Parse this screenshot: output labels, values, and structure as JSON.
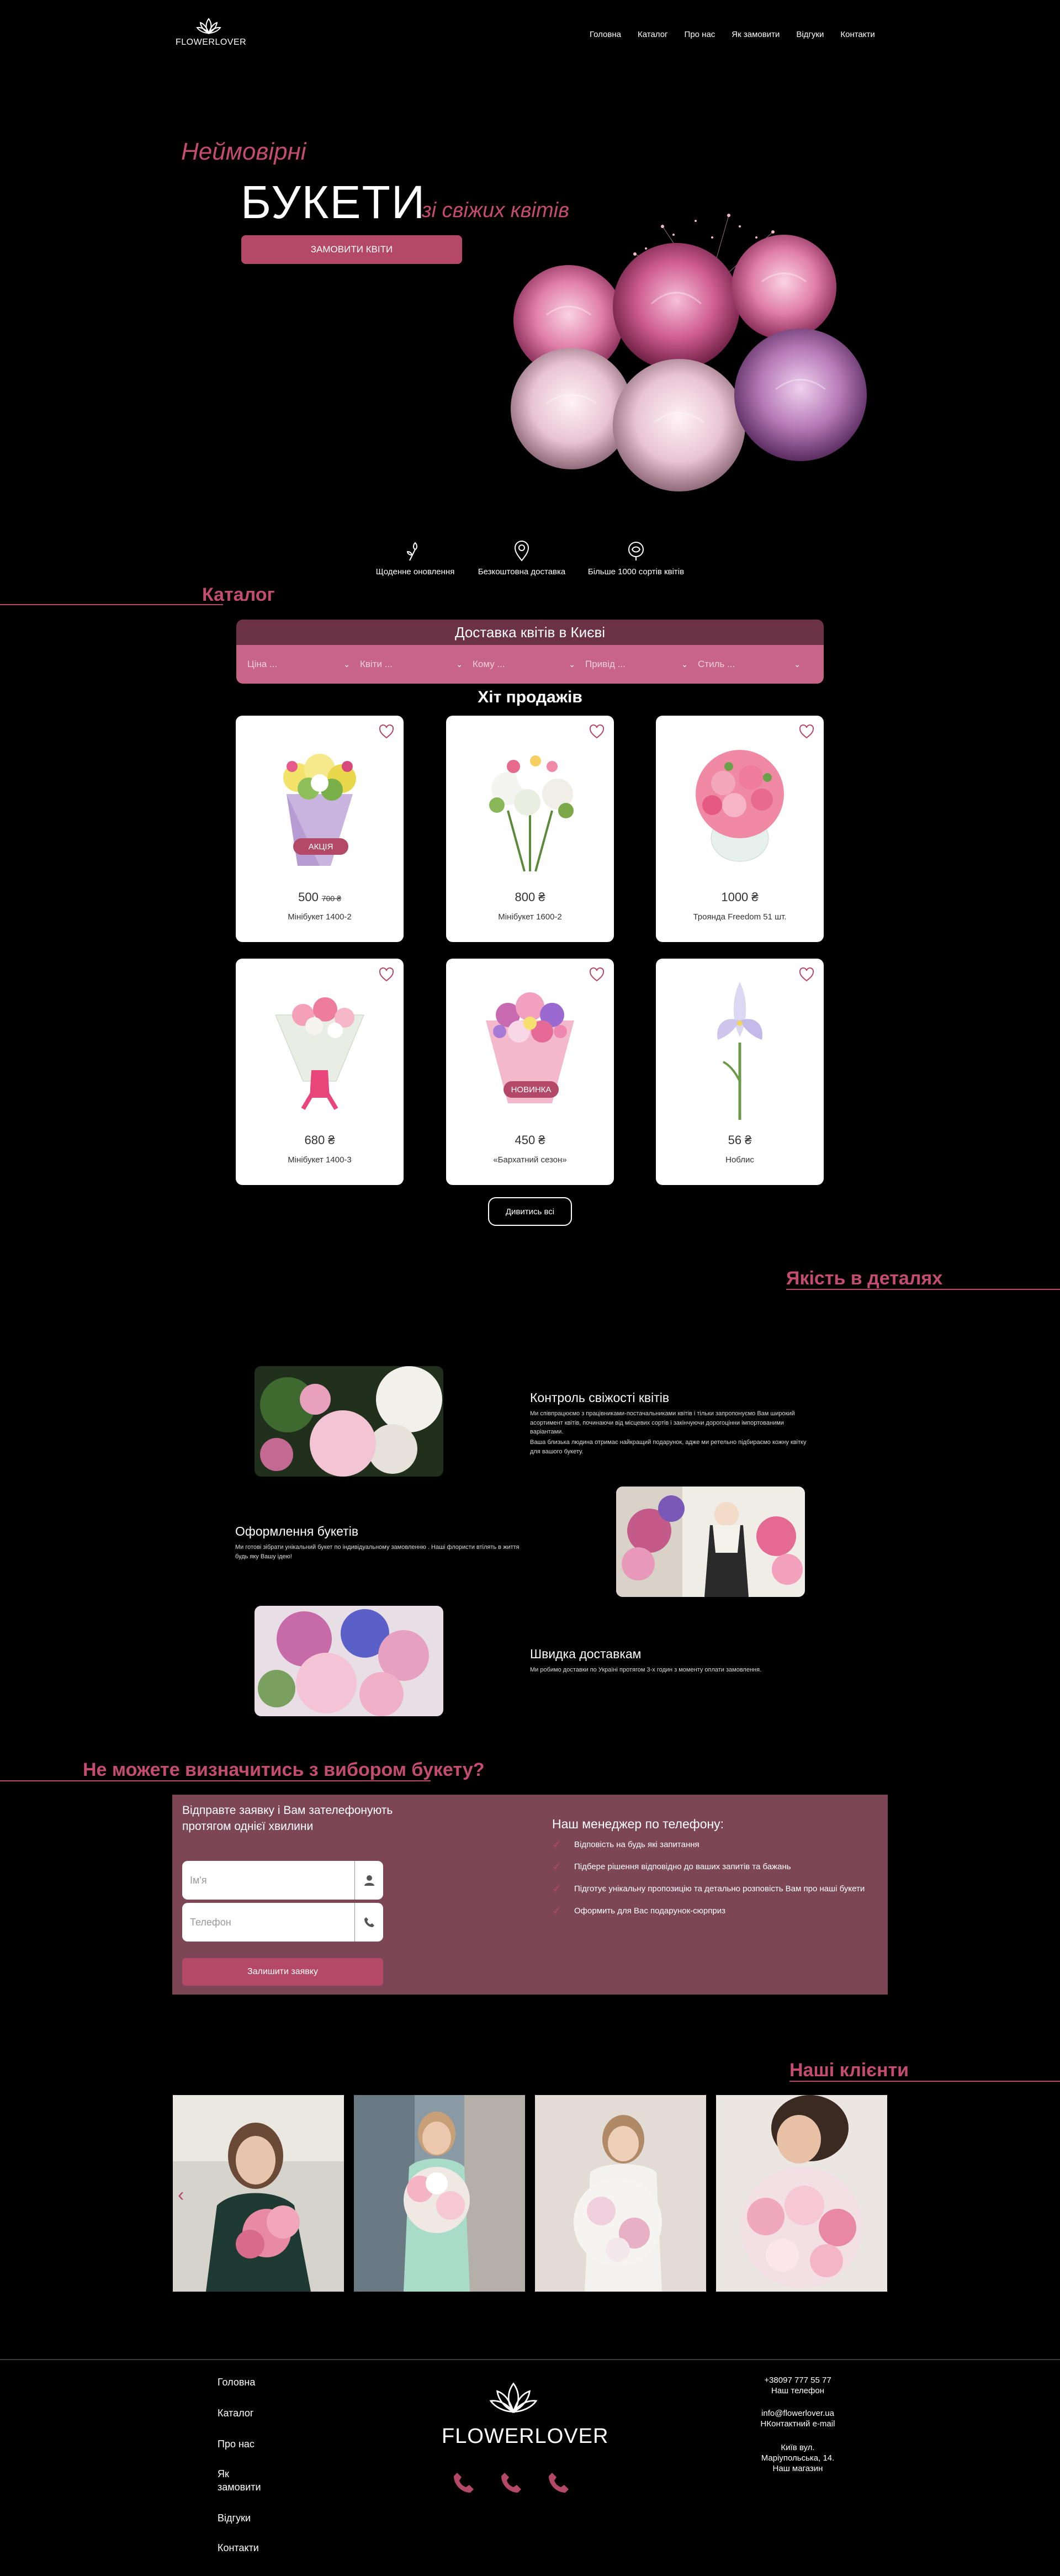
{
  "brand": {
    "name": "FLOWERLOVER",
    "accent": "#b44867",
    "accent_text": "#c44b72"
  },
  "nav": [
    "Головна",
    "Каталог",
    "Про нас",
    "Як замовити",
    "Відгуки",
    "Контакти"
  ],
  "hero": {
    "line1": "Неймовірні",
    "big": "БУКЕТИ",
    "sub": "зі свіжих квітів",
    "button": "ЗАМОВИТИ КВІТИ"
  },
  "features": [
    "Щоденне оновлення",
    "Безкоштовна доставка",
    "Більше 1000 сортів квітів"
  ],
  "catalog": {
    "title": "Каталог",
    "filter_title": "Доставка квітів в Києві",
    "filters": [
      "Ціна ...",
      "Квіти ...",
      "Кому ...",
      "Привід ...",
      "Стиль ..."
    ]
  },
  "hits": {
    "title": "Хіт продажів",
    "products": [
      {
        "name": "Мінібукет 1400-2",
        "price": "500",
        "old_price": "700 ₴",
        "badge": "АКЦІЯ",
        "flower": "yellow"
      },
      {
        "name": "Мінібукет 1600-2",
        "price": "800 ₴",
        "old_price": "",
        "badge": "",
        "flower": "white"
      },
      {
        "name": "Троянда Freedom 51 шт.",
        "price": "1000 ₴",
        "old_price": "",
        "badge": "",
        "flower": "pink"
      },
      {
        "name": "Мінібукет 1400-3",
        "price": "680 ₴",
        "old_price": "",
        "badge": "",
        "flower": "rose"
      },
      {
        "name": "«Бархатний сезон»",
        "price": "450 ₴",
        "old_price": "",
        "badge": "НОВИНКА",
        "flower": "mix"
      },
      {
        "name": "Ноблис",
        "price": "56 ₴",
        "old_price": "",
        "badge": "",
        "flower": "iris"
      }
    ],
    "more_button": "Дивитись всі"
  },
  "quality": {
    "title": "Якість в деталях",
    "items": [
      {
        "title": "Контроль свіжості квітів",
        "text": "Ми співпрацюємо з працівниками-постачальниками квітів і тільки запропонуємо Вам широкий асортимент квітів, починаючи від місцевих сортів і закінчуючи дорогоцінни імпортованими варіантами.",
        "text2": "Ваша близька людина отримає найкращий подарунок, адже ми ретельно підбираємо кожну квітку для вашого букету."
      },
      {
        "title": "Оформлення букетів",
        "text": "Ми готові зібрати унікальний букет по індивідуальному замовленню . Наші флористи втілять в життя будь яку Вашу ідею!",
        "text2": ""
      },
      {
        "title": "Швидка доставкам",
        "text": "Ми робимо доставки по Україні протягом 3-х годин з моменту оплати замовлення.",
        "text2": ""
      }
    ]
  },
  "request": {
    "section_title": "Не можете визначитись з вибором букету?",
    "title": "Відправте заявку і Вам зателефонують протягом однієї хвилини",
    "name_placeholder": "Ім'я",
    "phone_placeholder": "Телефон",
    "button": "Залишити заявку",
    "manager_title": "Наш менеджер по телефону:",
    "manager_items": [
      "Відповість на будь які запитання",
      "Підбере рішення відповідно до ваших запитів та бажань",
      "Підготує унікальну пропозицію та детально розповість Вам про наші букети",
      "Оформить для Вас подарунок-сюрприз"
    ]
  },
  "clients": {
    "title": "Наші клієнти",
    "arrow": "‹"
  },
  "footer": {
    "nav": [
      "Головна",
      "Каталог",
      "Про нас",
      "Як замовити",
      "Відгуки",
      "Контакти"
    ],
    "phone": "+38097 777 55 77",
    "phone_label": "Наш телефон",
    "email": "info@flowerlover.ua",
    "email_label": "НКонтактний e-mail",
    "address": "Київ вул. Маріупольська, 14.",
    "address_label": "Наш магазин"
  }
}
